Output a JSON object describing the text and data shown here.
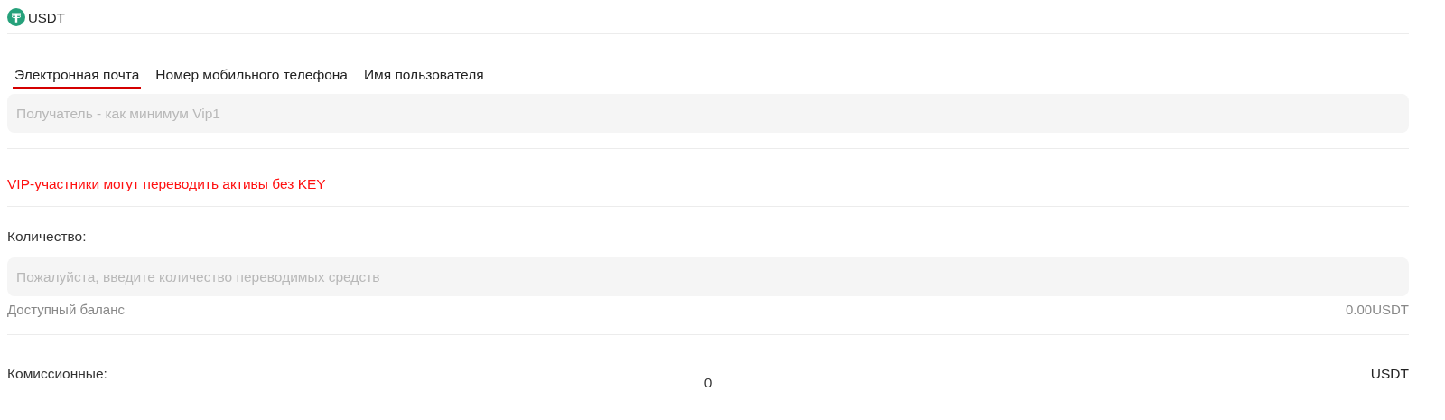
{
  "asset": {
    "symbol": "USDT"
  },
  "tabs": [
    {
      "label": "Электронная почта",
      "selected": true
    },
    {
      "label": "Номер мобильного телефона",
      "selected": false
    },
    {
      "label": "Имя пользователя",
      "selected": false
    }
  ],
  "recipient": {
    "placeholder": "Получатель - как минимум Vip1"
  },
  "notice": "VIP-участники могут переводить активы без KEY",
  "amount": {
    "label": "Количество:",
    "placeholder": "Пожалуйста, введите количество переводимых средств",
    "balance_label": "Доступный баланс",
    "balance_value": "0.00USDT"
  },
  "fees": {
    "label": "Комиссионные:",
    "value": "0",
    "unit": "USDT"
  }
}
